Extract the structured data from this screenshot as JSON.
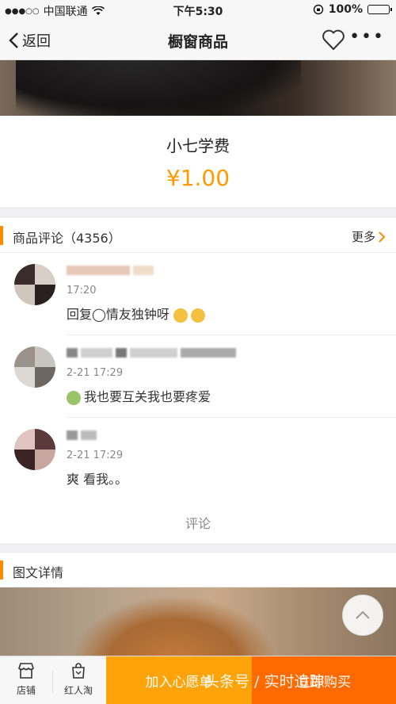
{
  "status_bar": {
    "carrier": "中国联通",
    "time": "下午5:30",
    "battery": "100%"
  },
  "nav": {
    "back_label": "返回",
    "title": "橱窗商品"
  },
  "product": {
    "name": "小七学费",
    "price": "¥1.00"
  },
  "reviews": {
    "title": "商品评论（4356）",
    "more_label": "更多",
    "items": [
      {
        "date": "17:20",
        "text": "回复◯情友独钟呀"
      },
      {
        "date": "2-21 17:29",
        "text": "我也要互关我也要疼爱"
      },
      {
        "date": "2-21 17:29",
        "text": "爽 看我。。"
      }
    ],
    "comment_label": "评论"
  },
  "detail": {
    "title": "图文详情"
  },
  "bottom_bar": {
    "shop_label": "店铺",
    "hongrentao_label": "红人淘",
    "wishlist_label": "加入心愿单",
    "buy_label": "立即购买"
  },
  "watermark": "头条号 / 实时追踪",
  "colors": {
    "accent_orange": "#ff9a00",
    "wishlist_bg": "#ffa30a",
    "buy_bg": "#ff6a00"
  }
}
